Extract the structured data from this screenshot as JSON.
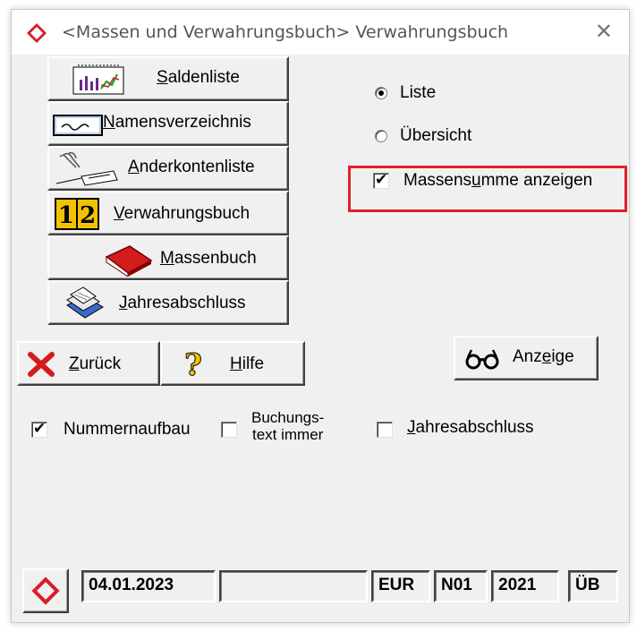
{
  "window": {
    "title": "<Massen und Verwahrungsbuch> Verwahrungsbuch"
  },
  "nav_buttons": [
    {
      "prefix": "",
      "u": "S",
      "rest": "aldenliste",
      "icon": "balance-list-icon"
    },
    {
      "prefix": "",
      "u": "N",
      "rest": "amensverzeichnis",
      "icon": "directory-card-icon"
    },
    {
      "prefix": "",
      "u": "A",
      "rest": "nderkontenliste",
      "icon": "hand-document-icon"
    },
    {
      "prefix": "",
      "u": "V",
      "rest": "erwahrungsbuch",
      "icon": "numbered-book-icon"
    },
    {
      "prefix": "",
      "u": "M",
      "rest": "assenbuch",
      "icon": "red-book-icon"
    },
    {
      "prefix": "",
      "u": "J",
      "rest": "ahresabschluss",
      "icon": "books-stack-icon"
    }
  ],
  "options": {
    "radio_liste": "Liste",
    "radio_liste_selected": true,
    "radio_uebersicht": "Übersicht",
    "radio_uebersicht_selected": false,
    "massensumme_pre": "Massens",
    "massensumme_u": "u",
    "massensumme_post": "mme anzeigen",
    "massensumme_checked": true
  },
  "actions": {
    "back_u": "Z",
    "back_rest": "urück",
    "help_u": "H",
    "help_rest": "ilfe",
    "anzeige_pre": "Anz",
    "anzeige_u": "e",
    "anzeige_post": "ige"
  },
  "bottom_checks": {
    "nummernaufbau": "Nummernaufbau",
    "nummernaufbau_checked": true,
    "buchungstext_line1": "Buchungs-",
    "buchungstext_line2": "text immer",
    "buchungstext_checked": false,
    "jahres_u": "J",
    "jahres_rest": "ahresabschluss",
    "jahres_checked": false
  },
  "status_bar": {
    "date": "04.01.2023",
    "empty": "",
    "currency": "EUR",
    "code": "N01",
    "year": "2021",
    "mode": "ÜB"
  },
  "colors": {
    "highlight": "#e0202a",
    "logo_red": "#d62027"
  }
}
